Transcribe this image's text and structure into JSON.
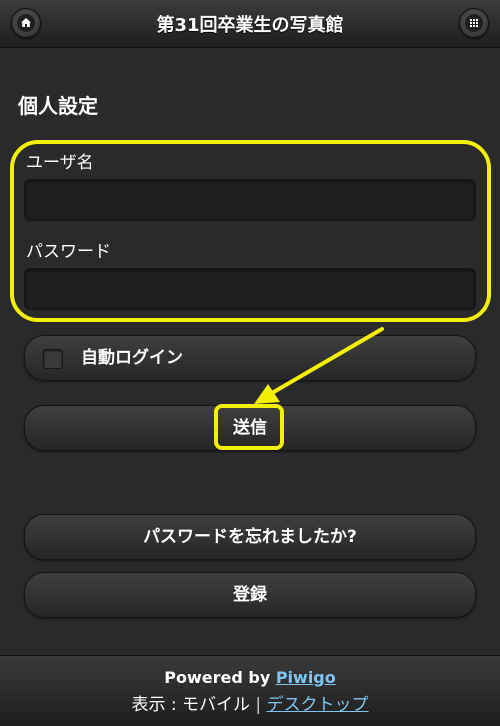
{
  "header": {
    "title": "第31回卒業生の写真館",
    "home_icon": "home-icon",
    "menu_icon": "grid-menu-icon"
  },
  "form": {
    "section_title": "個人設定",
    "username_label": "ユーザ名",
    "username_value": "",
    "password_label": "パスワード",
    "password_value": "",
    "auto_login_label": "自動ログイン",
    "auto_login_checked": false,
    "submit_label": "送信"
  },
  "actions": {
    "forgot_password_label": "パスワードを忘れましたか?",
    "register_label": "登録"
  },
  "footer": {
    "powered_by": "Powered by",
    "piwigo_link": "Piwigo",
    "view_label": "表示 : モバイル",
    "separator": "|",
    "desktop_link": "デスクトップ"
  },
  "colors": {
    "annotation": "#f4f000",
    "link": "#7fc6f2",
    "background": "#2a2a2a"
  }
}
